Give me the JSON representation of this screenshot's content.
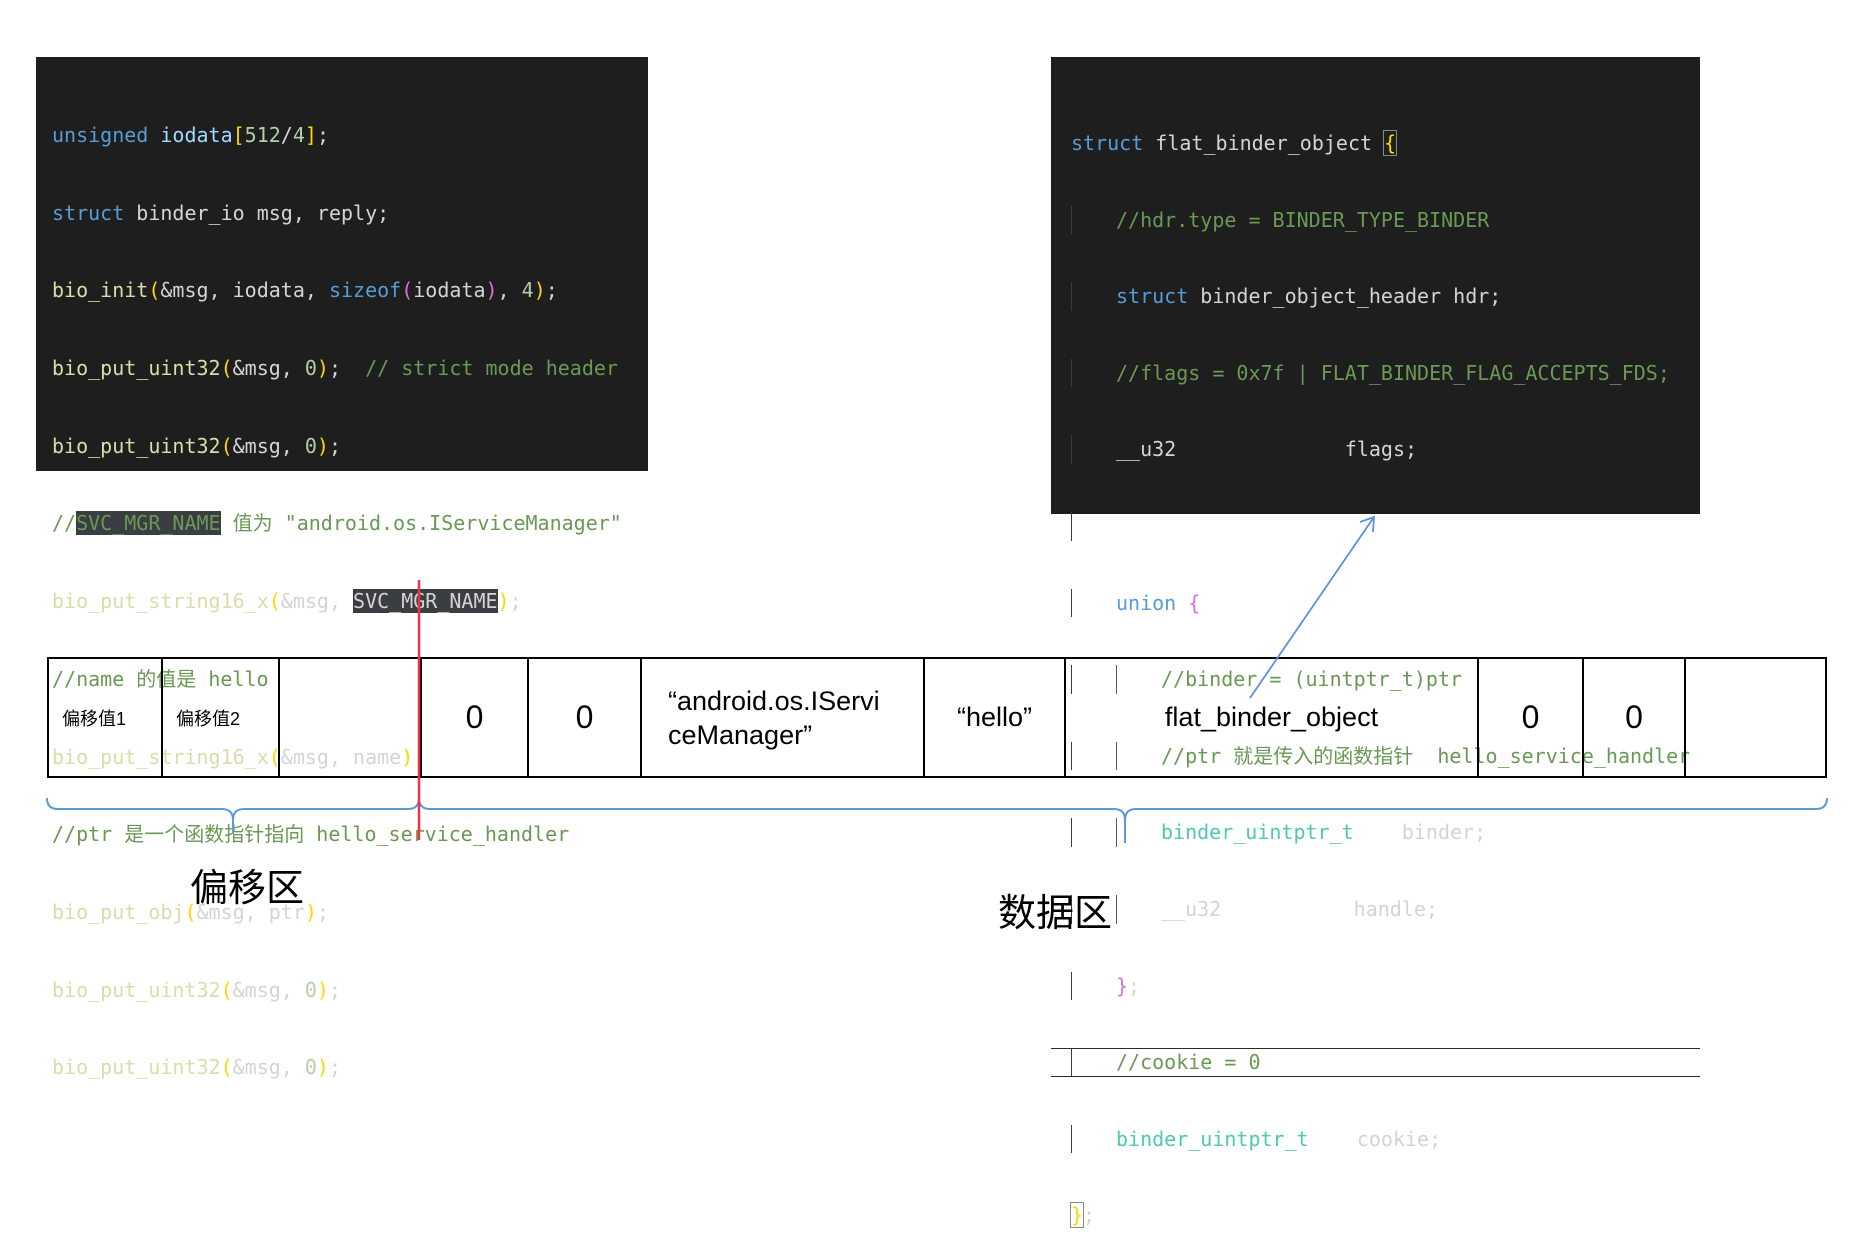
{
  "left_code": {
    "lines": [
      {
        "t1": "unsigned",
        "t2": " ",
        "t3": "iodata",
        "t4": "[",
        "t5": "512",
        "t6": "/",
        "t7": "4",
        "t8": "]",
        "t9": ";"
      },
      {
        "t1": "struct",
        "t2": " binder_io msg, reply;"
      },
      {
        "t1": "bio_init",
        "t2": "(",
        "t3": "&msg, iodata, ",
        "t4": "sizeof",
        "t5": "(",
        "t6": "iodata",
        "t7": ")",
        "t8": ", ",
        "t9": "4",
        "t10": ")",
        "t11": ";"
      },
      {
        "t1": "bio_put_uint32",
        "t2": "(",
        "t3": "&msg, ",
        "t4": "0",
        "t5": ")",
        "t6": ";  ",
        "t7": "// strict mode header"
      },
      {
        "t1": "bio_put_uint32",
        "t2": "(",
        "t3": "&msg, ",
        "t4": "0",
        "t5": ")",
        "t6": ";"
      },
      {
        "t1": "//",
        "t2": "SVC_MGR_NAME",
        "t3": " 值为 \"android.os.IServiceManager\""
      },
      {
        "t1": "bio_put_string16_x",
        "t2": "(",
        "t3": "&msg, ",
        "t4": "SVC_MGR_NAME",
        "t5": ")",
        "t6": ";"
      },
      {
        "t1": "//name 的值是 hello"
      },
      {
        "t1": "bio_put_string16_x",
        "t2": "(",
        "t3": "&msg, name",
        "t4": ")",
        "t5": ";"
      },
      {
        "t1": "//ptr 是一个函数指针指向 hello_service_handler"
      },
      {
        "t1": "bio_put_obj",
        "t2": "(",
        "t3": "&msg, ptr",
        "t4": ")",
        "t5": ";"
      },
      {
        "t1": "bio_put_uint32",
        "t2": "(",
        "t3": "&msg, ",
        "t4": "0",
        "t5": ")",
        "t6": ";"
      },
      {
        "t1": "bio_put_uint32",
        "t2": "(",
        "t3": "&msg, ",
        "t4": "0",
        "t5": ")",
        "t6": ";"
      }
    ]
  },
  "right_code": {
    "lines": [
      {
        "t1": "struct",
        "t2": " flat_binder_object ",
        "t3": "{"
      },
      {
        "t1": "//hdr.type = BINDER_TYPE_BINDER"
      },
      {
        "t1": "struct",
        "t2": " binder_object_header hdr;"
      },
      {
        "t1": "//flags = 0x7f | FLAT_BINDER_FLAG_ACCEPTS_FDS;"
      },
      {
        "t1": "__u32",
        "t2": "              flags;"
      },
      {
        "t1": ""
      },
      {
        "t1": "union",
        "t2": " ",
        "t3": "{"
      },
      {
        "t1": "//binder = (uintptr_t)ptr"
      },
      {
        "t1": "//ptr 就是传入的函数指针  hello_service_handler"
      },
      {
        "t1": "binder_uintptr_t",
        "t2": "    binder;"
      },
      {
        "t1": "__u32",
        "t2": "           handle;"
      },
      {
        "t1": "}",
        "t2": ";"
      },
      {
        "t1": "//cookie = 0"
      },
      {
        "t1": "binder_uintptr_t",
        "t2": "    cookie;"
      },
      {
        "t1": "}",
        "t2": ";"
      }
    ]
  },
  "buffer": {
    "cells": [
      "偏移值1",
      "偏移值2",
      "",
      "0",
      "0",
      "“android.os.IServi",
      "ceManager”",
      "“hello”",
      "flat_binder_object",
      "0",
      "0",
      ""
    ]
  },
  "labels": {
    "offset_zone": "偏移区",
    "data_zone": "数据区"
  },
  "colors": {
    "code_bg": "#1e1e1e",
    "divider_red": "#e8344a",
    "brace_blue": "#5b9bd5",
    "arrow_blue": "#5b8fe0"
  }
}
